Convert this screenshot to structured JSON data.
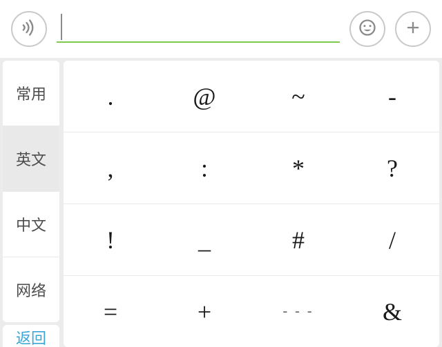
{
  "topbar": {
    "input_value": "",
    "input_placeholder": ""
  },
  "sidebar": {
    "categories": [
      {
        "label": "常用",
        "active": false
      },
      {
        "label": "英文",
        "active": true
      },
      {
        "label": "中文",
        "active": false
      },
      {
        "label": "网络",
        "active": false
      }
    ],
    "back_label": "返回"
  },
  "grid": {
    "rows": [
      [
        ".",
        "@",
        "~",
        "-"
      ],
      [
        ",",
        ":",
        "*",
        "?"
      ],
      [
        "!",
        "_",
        "#",
        "/"
      ],
      [
        "=",
        "+",
        "- - -",
        "&"
      ]
    ]
  },
  "colors": {
    "accent_underline": "#7cc94d",
    "icon_gray": "#8a8a8a",
    "active_bg": "#e9e9e9",
    "back_text": "#3aa6d8"
  }
}
